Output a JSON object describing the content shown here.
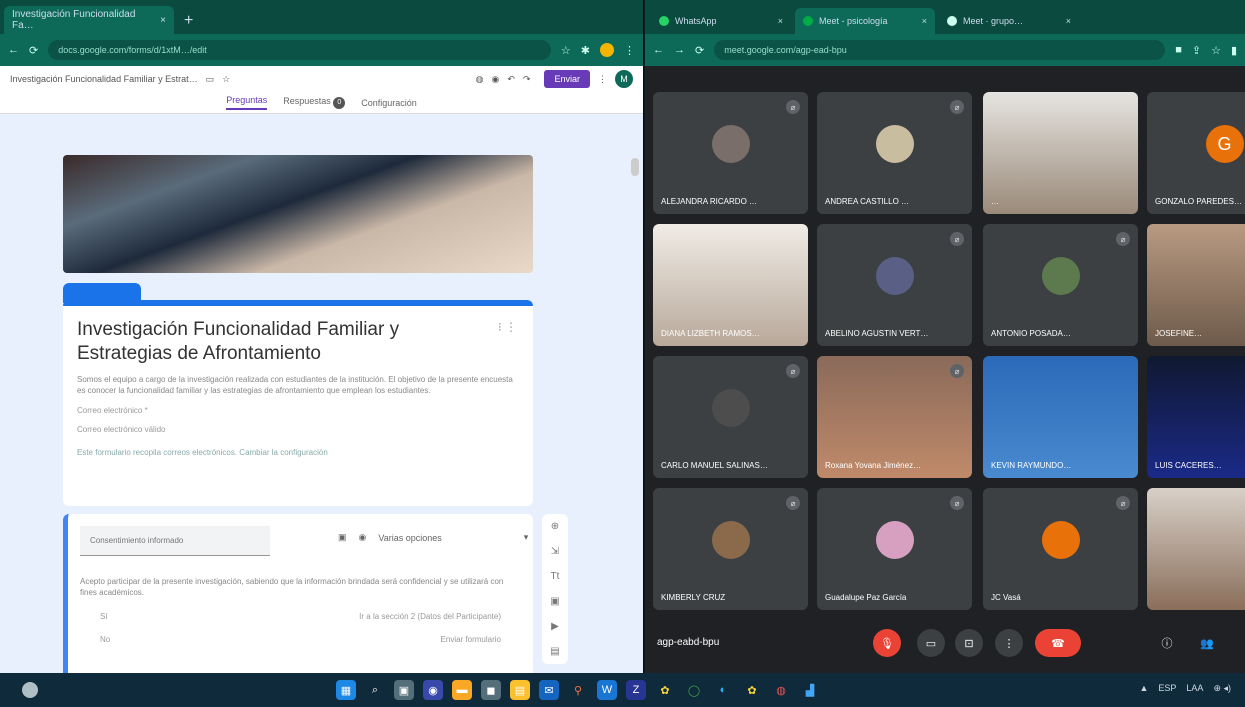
{
  "left_window": {
    "tab_title": "Investigación Funcionalidad Fa…",
    "tab_close": "×",
    "new_tab": "+",
    "url": "docs.google.com/forms/d/1xtM…/edit",
    "forms_header_title": "Investigación Funcionalidad Familiar y Estrat…",
    "send_label": "Enviar",
    "avatar_letter": "M",
    "tabs": [
      {
        "label": "Preguntas"
      },
      {
        "label": "Respuestas"
      },
      {
        "label": "Configuración"
      }
    ],
    "responses_badge": "0",
    "form": {
      "title": "Investigación Funcionalidad Familiar y Estrategias de Afrontamiento",
      "description": "Somos el equipo a cargo de la investigación realizada con estudiantes de la institución. El objetivo de la presente encuesta es conocer la funcionalidad familiar y las estrategias de afrontamiento que emplean los estudiantes.",
      "line1": "Correo electrónico *",
      "line2": "Correo electrónico válido",
      "line3": "Este formulario recopila correos electrónicos. Cambiar la configuración"
    },
    "question": {
      "input_placeholder": "Consentimiento informado",
      "type_label": "Varias opciones",
      "text": "Acepto participar de la presente investigación, sabiendo que la información brindada será confidencial y se utilizará con fines académicos.",
      "option1": "Sí",
      "option1_right": "Ir a la sección 2 (Datos del Participante)",
      "option2": "No",
      "option2_right": "Enviar formulario"
    }
  },
  "right_window": {
    "tabs": [
      {
        "label": "WhatsApp",
        "color": "#25d366"
      },
      {
        "label": "Meet - psicología",
        "color": "#00ac47"
      },
      {
        "label": "Meet · grupo…",
        "color": "#cfe"
      }
    ],
    "url": "meet.google.com/agp-ead-bpu",
    "meeting_code": "agp-eabd-bpu",
    "participants": [
      {
        "name": "ALEJANDRA RICARDO …"
      },
      {
        "name": "ANDREA CASTILLO …"
      },
      {
        "name": "…"
      },
      {
        "name": "GONZALO PAREDES…"
      },
      {
        "name": "DIANA LIZBETH RAMOS…"
      },
      {
        "name": "ABELINO AGUSTIN VERT…"
      },
      {
        "name": "ANTONIO POSADA…"
      },
      {
        "name": "JOSEFINE…"
      },
      {
        "name": "CARLO MANUEL SALINAS…"
      },
      {
        "name": "Roxana Yovana Jiménez…"
      },
      {
        "name": "KEVIN RAYMUNDO…"
      },
      {
        "name": "LUIS CACERES…"
      },
      {
        "name": "KIMBERLY CRUZ"
      },
      {
        "name": "Guadalupe Paz García"
      },
      {
        "name": "JC Vasá"
      },
      {
        "name": ""
      }
    ],
    "g_letter": "G"
  },
  "taskbar": {
    "tray": [
      "▲",
      "ESP",
      "LAA",
      "⊕ ◂)"
    ]
  }
}
